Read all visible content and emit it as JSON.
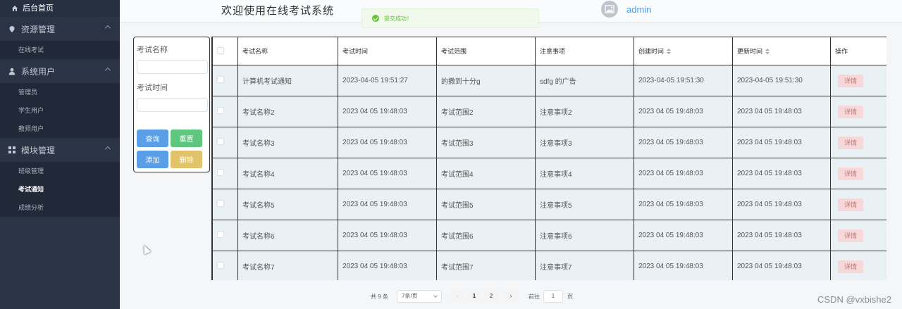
{
  "sidebar": {
    "home_label": "后台首页",
    "groups": [
      {
        "label": "资源管理",
        "icon": "location-icon",
        "items": [
          "在线考试"
        ]
      },
      {
        "label": "系统用户",
        "icon": "user-icon",
        "items": [
          "管理员",
          "学生用户",
          "教师用户"
        ]
      },
      {
        "label": "模块管理",
        "icon": "grid-icon",
        "items": [
          "班级管理",
          "考试通知",
          "成绩分析"
        ]
      }
    ],
    "active_item": "考试通知"
  },
  "header": {
    "welcome": "欢迎使用在线考试系统",
    "username": "admin"
  },
  "toast": {
    "message": "提交成功！"
  },
  "filter": {
    "name_label": "考试名称",
    "name_value": "",
    "time_label": "考试时间",
    "time_value": "",
    "query": "查询",
    "reset": "重置",
    "add": "添加",
    "delete": "删除"
  },
  "table": {
    "headers": [
      "考试名称",
      "考试时间",
      "考试范围",
      "注意事项",
      "创建时间",
      "更新时间",
      "操作"
    ],
    "detail_label": "详情",
    "rows": [
      [
        "计算机考试通知",
        "2023-04-05 19:51:27",
        "的撒到十分g",
        "sdfg 的广告",
        "2023-04-05 19:51:30",
        "2023-04-05 19:51:30"
      ],
      [
        "考试名称2",
        "2023 04 05 19:48:03",
        "考试范围2",
        "注意事项2",
        "2023 04 05 19:48:03",
        "2023 04 05 19:48:03"
      ],
      [
        "考试名称3",
        "2023 04 05 19:48:03",
        "考试范围3",
        "注意事项3",
        "2023 04 05 19:48:03",
        "2023 04 05 19:48:03"
      ],
      [
        "考试名称4",
        "2023 04 05 19:48:03",
        "考试范围4",
        "注意事项4",
        "2023 04 05 19:48:03",
        "2023 04 05 19:48:03"
      ],
      [
        "考试名称5",
        "2023 04 05 19:48:03",
        "考试范围5",
        "注意事项5",
        "2023 04 05 19:48:03",
        "2023 04 05 19:48:03"
      ],
      [
        "考试名称6",
        "2023 04 05 19:48:03",
        "考试范围6",
        "注意事项6",
        "2023 04 05 19:48:03",
        "2023 04 05 19:48:03"
      ],
      [
        "考试名称7",
        "2023 04 05 19:48:03",
        "考试范围7",
        "注意事项7",
        "2023 04 05 19:48:03",
        "2023 04 05 19:48:03"
      ]
    ]
  },
  "pagination": {
    "total": "共 9 条",
    "page_size": "7条/页",
    "prev": "‹",
    "pages": [
      "1",
      "2"
    ],
    "next": "›",
    "goto": "前往",
    "jump_value": "1",
    "unit": "页"
  },
  "watermark": "CSDN @vxbishe2"
}
